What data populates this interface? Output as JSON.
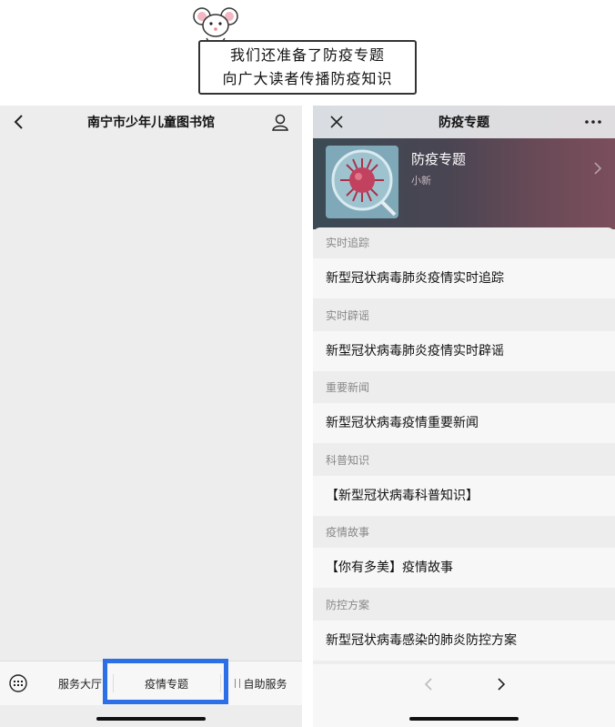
{
  "banner": {
    "line1": "我们还准备了防疫专题",
    "line2": "向广大读者传播防疫知识"
  },
  "left_phone": {
    "title": "南宁市少年儿童图书馆",
    "tabs": [
      {
        "label": "服务大厅"
      },
      {
        "label": "疫情专题"
      },
      {
        "label": "自助服务"
      }
    ]
  },
  "right_phone": {
    "title": "防疫专题",
    "header": {
      "name": "防疫专题",
      "sub": "小新"
    },
    "sections": [
      {
        "title": "实时追踪",
        "item": "新型冠状病毒肺炎疫情实时追踪"
      },
      {
        "title": "实时辟谣",
        "item": "新型冠状病毒肺炎疫情实时辟谣"
      },
      {
        "title": "重要新闻",
        "item": "新型冠状病毒疫情重要新闻"
      },
      {
        "title": "科普知识",
        "item": "【新型冠状病毒科普知识】"
      },
      {
        "title": "疫情故事",
        "item": "【你有多美】疫情故事"
      },
      {
        "title": "防控方案",
        "item": "新型冠状病毒感染的肺炎防控方案"
      }
    ]
  },
  "colors": {
    "highlight": "#2d6fe6",
    "header_gradient_start": "#3b4a54",
    "header_gradient_end": "#7b4e5c"
  }
}
